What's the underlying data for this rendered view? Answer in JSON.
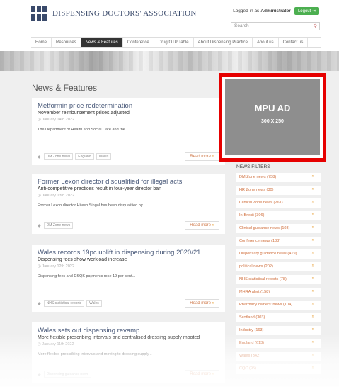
{
  "header": {
    "site_name": "DISPENSING DOCTORS' ASSOCIATION",
    "login_prefix": "Logged in as",
    "login_user": "Administrator",
    "logout_label": "Logout",
    "search_placeholder": "Search"
  },
  "nav": {
    "items": [
      {
        "label": "Home",
        "active": false
      },
      {
        "label": "Resources",
        "active": false
      },
      {
        "label": "News & Features",
        "active": true
      },
      {
        "label": "Conference",
        "active": false
      },
      {
        "label": "Drug/OTP Table",
        "active": false
      },
      {
        "label": "About Dispensing Practice",
        "active": false
      },
      {
        "label": "About us",
        "active": false
      },
      {
        "label": "Contact us",
        "active": false
      }
    ]
  },
  "main": {
    "page_title": "News & Features",
    "articles": [
      {
        "title": "Metformin price redetermination",
        "subtitle": "November reimbursement prices adjusted",
        "date": "January 14th 2022",
        "excerpt": "The Department of Health and Social Care and the...",
        "tags": [
          "DM Zone news",
          "England",
          "Wales"
        ],
        "read_more": "Read more"
      },
      {
        "title": "Former Lexon director disqualified for illegal acts",
        "subtitle": "Anti-competitive practices result in four-year director ban",
        "date": "January 13th 2022",
        "excerpt": "Former Lexon director Hitesh Singal has been disqualified by...",
        "tags": [
          "DM Zone news"
        ],
        "read_more": "Read more"
      },
      {
        "title": "Wales records 19pc uplift in dispensing during 2020/21",
        "subtitle": "Dispensing fees show workload increase",
        "date": "January 12th 2022",
        "excerpt": "Dispensing fees and DSQS payments rose 19 per cent...",
        "tags": [
          "NHS statistical reports",
          "Wales"
        ],
        "read_more": "Read more"
      },
      {
        "title": "Wales sets out dispensing revamp",
        "subtitle": "More flexible prescribing intervals and centralised dressing supply mooted",
        "date": "January 11th 2022",
        "excerpt": "More flexible prescribing intervals and moving to dressing supply...",
        "tags": [
          "Dispensing guidance news"
        ],
        "read_more": "Read more"
      }
    ]
  },
  "sidebar": {
    "ad_title": "MPU AD",
    "ad_size": "300 X 250",
    "filters_title": "NEWS FILTERS",
    "filters": [
      "DM Zone news (758)",
      "HR Zone news (30)",
      "Clinical Zone news (261)",
      "In-Brexit (306)",
      "Clinical guidance news (103)",
      "Conference news (138)",
      "Dispensary guidance news (419)",
      "political news (202)",
      "NHS statistical reports (78)",
      "MHRA alert (158)",
      "Pharmacy owners' news (104)",
      "Scotland (303)",
      "Industry (163)",
      "England (613)",
      "Wales (342)",
      "CQC (95)"
    ]
  },
  "icons": {
    "search": "search-icon",
    "tag": "tag-icon",
    "arrow": "chevron-right-icon",
    "clock": "clock-icon"
  },
  "colors": {
    "accent": "#d0703e",
    "logout": "#4caf50",
    "ad_border": "#e60000",
    "nav_active": "#333333"
  }
}
